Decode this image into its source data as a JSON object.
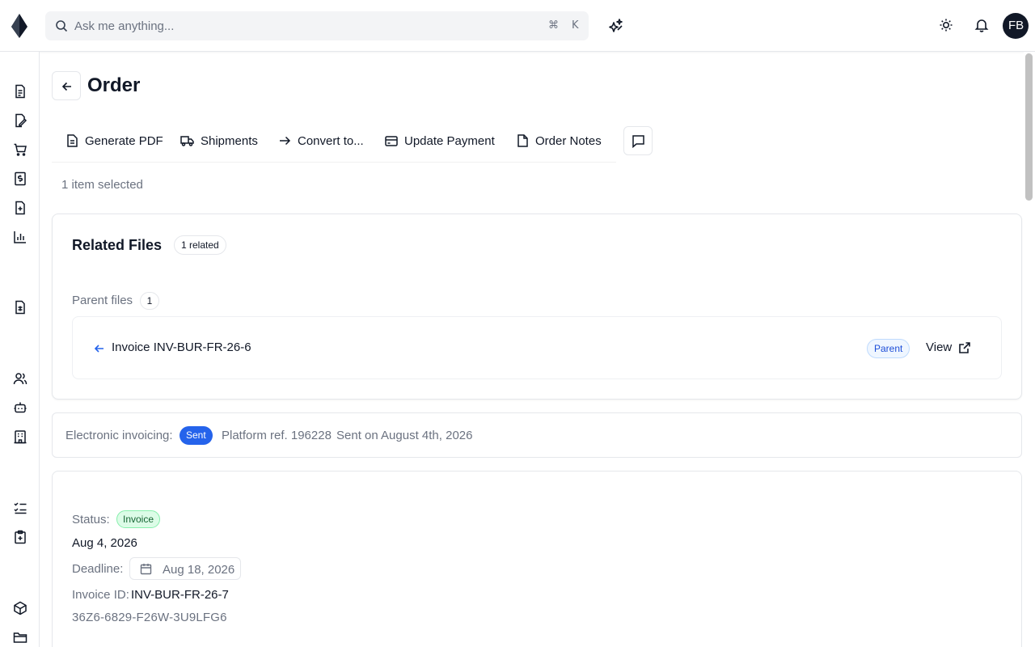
{
  "search": {
    "placeholder": "Ask me anything...",
    "shortcut_mod": "⌘",
    "shortcut_key": "K"
  },
  "user": {
    "initials": "FB"
  },
  "page": {
    "title": "Order"
  },
  "toolbar": {
    "generate_pdf": "Generate PDF",
    "shipments": "Shipments",
    "convert": "Convert to...",
    "update_payment": "Update Payment",
    "order_notes": "Order Notes"
  },
  "selection": {
    "text": "1 item selected"
  },
  "related": {
    "title": "Related Files",
    "count_label": "1 related",
    "parent_label": "Parent files",
    "parent_count": "1",
    "file": {
      "name": "Invoice INV-BUR-FR-26-6",
      "badge": "Parent",
      "action": "View"
    }
  },
  "einvoicing": {
    "label": "Electronic invoicing:",
    "status": "Sent",
    "platform_ref": "Platform ref. 196228",
    "sent_on": "Sent on August 4th, 2026"
  },
  "details": {
    "status_label": "Status:",
    "status_value": "Invoice",
    "date": "Aug 4, 2026",
    "deadline_label": "Deadline:",
    "deadline_value": "Aug 18, 2026",
    "invoice_id_label": "Invoice ID:",
    "invoice_id_value": "INV-BUR-FR-26-7",
    "code": "36Z6-6829-F26W-3U9LFG6"
  },
  "colors": {
    "accent": "#2563eb",
    "status_green": "#dcfce7",
    "text": "#111827",
    "muted": "#6b7280"
  }
}
